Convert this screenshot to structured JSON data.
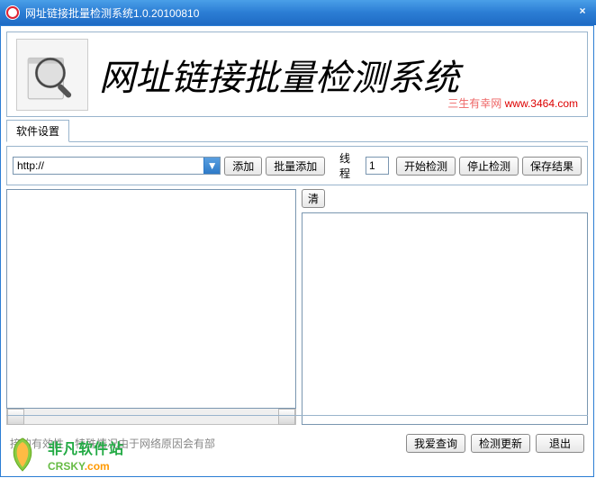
{
  "window": {
    "title": "网址链接批量检测系统1.0.20100810",
    "close_glyph": "×"
  },
  "header": {
    "title": "网址链接批量检测系统",
    "credit_prefix": "三生有幸网 ",
    "credit_url": "www.3464.com"
  },
  "tabs": {
    "settings": "软件设置"
  },
  "toolbar": {
    "url_value": "http://",
    "dropdown_glyph": "▼",
    "add": "添加",
    "batch_add": "批量添加",
    "thread_label": "线程",
    "thread_value": "1",
    "start": "开始检测",
    "stop": "停止检测",
    "save": "保存结果"
  },
  "panes": {
    "clear": "清",
    "left_content": "",
    "right_content": ""
  },
  "footer": {
    "hint": "接的有效性，特殊情况由于网络原因会有部",
    "query": "我爱查询",
    "update": "检测更新",
    "exit": "退出"
  },
  "watermark": {
    "cn": "非凡软件站",
    "en_left": "CRSKY",
    "en_right": ".com"
  }
}
